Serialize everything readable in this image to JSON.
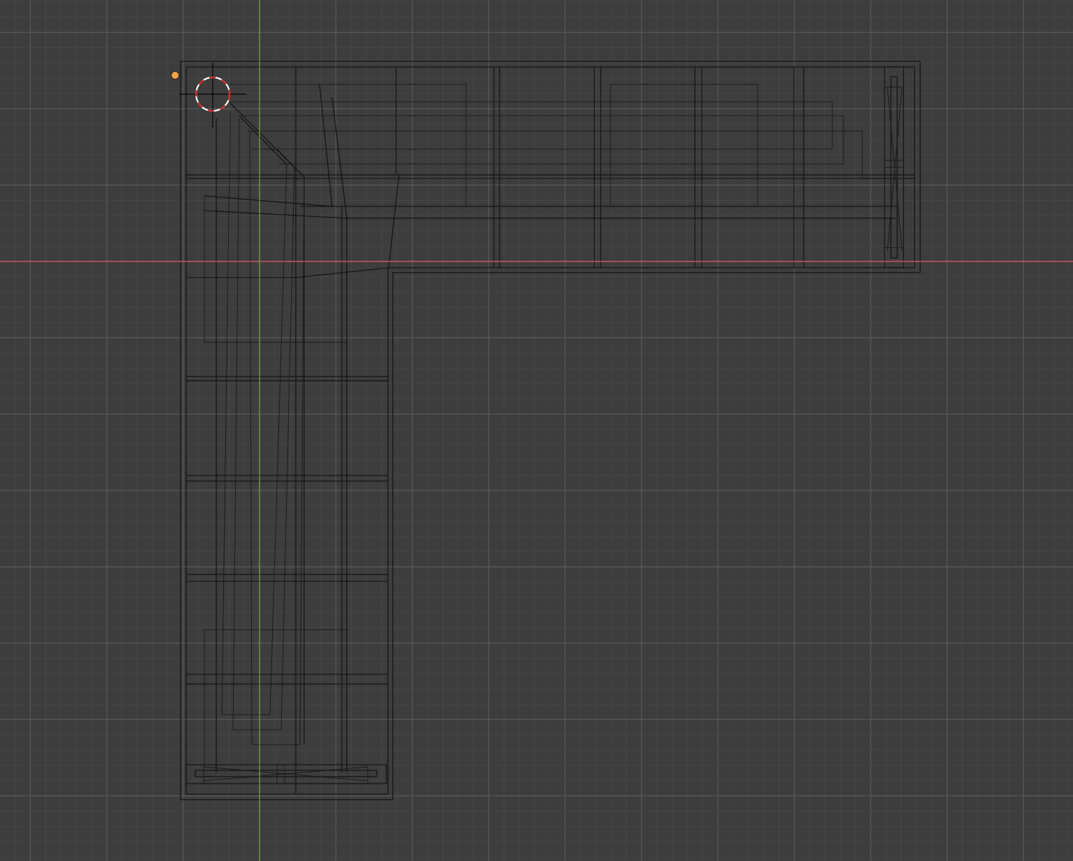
{
  "viewport": {
    "view": "top-orthographic-wireframe",
    "colors": {
      "background": "#3d3d3d",
      "grid_minor": "#474747",
      "grid_major": "#575757",
      "x_axis": "#c4525c",
      "y_axis": "#6f9a3a",
      "wire": "#141414",
      "origin_dot": "#f1a34a",
      "cursor_red": "#c8302c",
      "cursor_white": "#ffffff"
    },
    "icons": {
      "origin": "object-origin-dot-icon",
      "cursor": "3d-cursor-icon"
    }
  }
}
